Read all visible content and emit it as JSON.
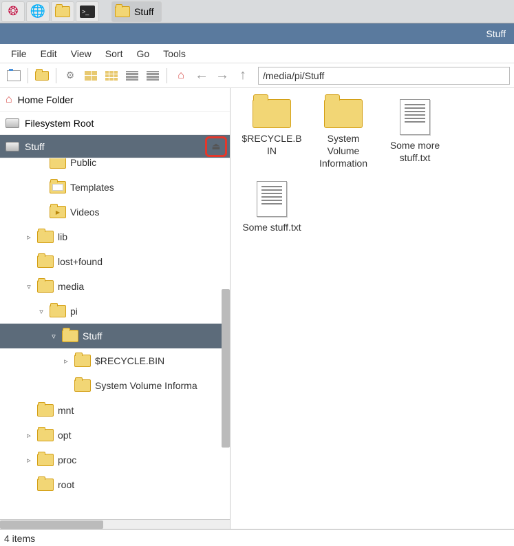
{
  "taskbar": {
    "app_label": "Stuff"
  },
  "titlebar": {
    "title": "Stuff"
  },
  "menu": [
    "File",
    "Edit",
    "View",
    "Sort",
    "Go",
    "Tools"
  ],
  "path": "/media/pi/Stuff",
  "places": [
    {
      "label": "Home Folder",
      "icon": "home",
      "selected": false,
      "ejectable": false
    },
    {
      "label": "Filesystem Root",
      "icon": "disk",
      "selected": false,
      "ejectable": false
    },
    {
      "label": "Stuff",
      "icon": "disk",
      "selected": true,
      "ejectable": true
    }
  ],
  "tree": [
    {
      "indent": 3,
      "expander": "",
      "icon": "folder",
      "label": "Public",
      "selected": false,
      "cut": true
    },
    {
      "indent": 3,
      "expander": "",
      "icon": "templates",
      "label": "Templates",
      "selected": false
    },
    {
      "indent": 3,
      "expander": "",
      "icon": "videos",
      "label": "Videos",
      "selected": false
    },
    {
      "indent": 2,
      "expander": "▹",
      "icon": "folder",
      "label": "lib",
      "selected": false
    },
    {
      "indent": 2,
      "expander": "",
      "icon": "folder",
      "label": "lost+found",
      "selected": false
    },
    {
      "indent": 2,
      "expander": "▿",
      "icon": "folder",
      "label": "media",
      "selected": false
    },
    {
      "indent": 3,
      "expander": "▿",
      "icon": "folder",
      "label": "pi",
      "selected": false
    },
    {
      "indent": 4,
      "expander": "▿",
      "icon": "folder",
      "label": "Stuff",
      "selected": true
    },
    {
      "indent": 5,
      "expander": "▹",
      "icon": "folder",
      "label": "$RECYCLE.BIN",
      "selected": false
    },
    {
      "indent": 5,
      "expander": "",
      "icon": "folder",
      "label": "System Volume Informa",
      "selected": false
    },
    {
      "indent": 2,
      "expander": "",
      "icon": "folder",
      "label": "mnt",
      "selected": false
    },
    {
      "indent": 2,
      "expander": "▹",
      "icon": "folder",
      "label": "opt",
      "selected": false
    },
    {
      "indent": 2,
      "expander": "▹",
      "icon": "folder",
      "label": "proc",
      "selected": false
    },
    {
      "indent": 2,
      "expander": "",
      "icon": "folder",
      "label": "root",
      "selected": false
    }
  ],
  "items": [
    {
      "type": "folder",
      "label": "$RECYCLE.BIN"
    },
    {
      "type": "folder",
      "label": "System Volume Information"
    },
    {
      "type": "file",
      "label": "Some more stuff.txt"
    },
    {
      "type": "file",
      "label": "Some stuff.txt"
    }
  ],
  "status": "4 items"
}
